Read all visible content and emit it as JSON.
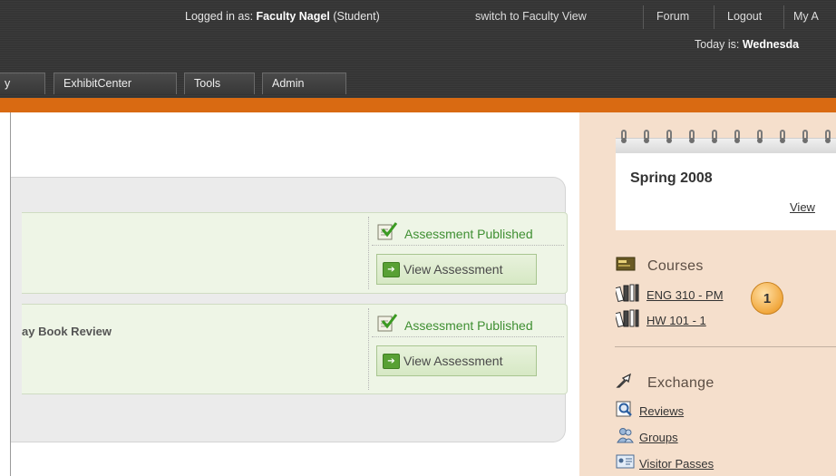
{
  "header": {
    "logged_in_prefix": "Logged in as:",
    "user_name": "Faculty Nagel",
    "user_role": "(Student)",
    "switch_view": "switch to Faculty View",
    "forum": "Forum",
    "logout": "Logout",
    "my_account": "My A",
    "today_prefix": "Today is:",
    "today_value": "Wednesda"
  },
  "nav": {
    "tabs": [
      {
        "label": "y"
      },
      {
        "label": "ExhibitCenter"
      },
      {
        "label": "Tools"
      },
      {
        "label": "Admin"
      }
    ]
  },
  "assessments": [
    {
      "title": "",
      "status": "Assessment Published",
      "action": "View Assessment"
    },
    {
      "title": "ay Book Review",
      "status": "Assessment Published",
      "action": "View Assessment"
    }
  ],
  "sidebar": {
    "calendar": {
      "term": "Spring 2008",
      "link": "View"
    },
    "courses": {
      "heading": "Courses",
      "items": [
        {
          "label": "ENG 310 - PM"
        },
        {
          "label": "HW 101 - 1"
        }
      ]
    },
    "exchange": {
      "heading": "Exchange",
      "items": [
        {
          "label": "Reviews",
          "icon": "magnifier-icon"
        },
        {
          "label": "Groups",
          "icon": "people-icon"
        },
        {
          "label": "Visitor Passes",
          "icon": "pass-card-icon"
        }
      ]
    }
  },
  "callout": {
    "number": "1"
  },
  "colors": {
    "accent_orange": "#d96a12",
    "header_dark": "#333333",
    "sidebar_bg": "#f5dfcc",
    "status_green": "#3f8f32",
    "badge_orange": "#f1a83e"
  }
}
